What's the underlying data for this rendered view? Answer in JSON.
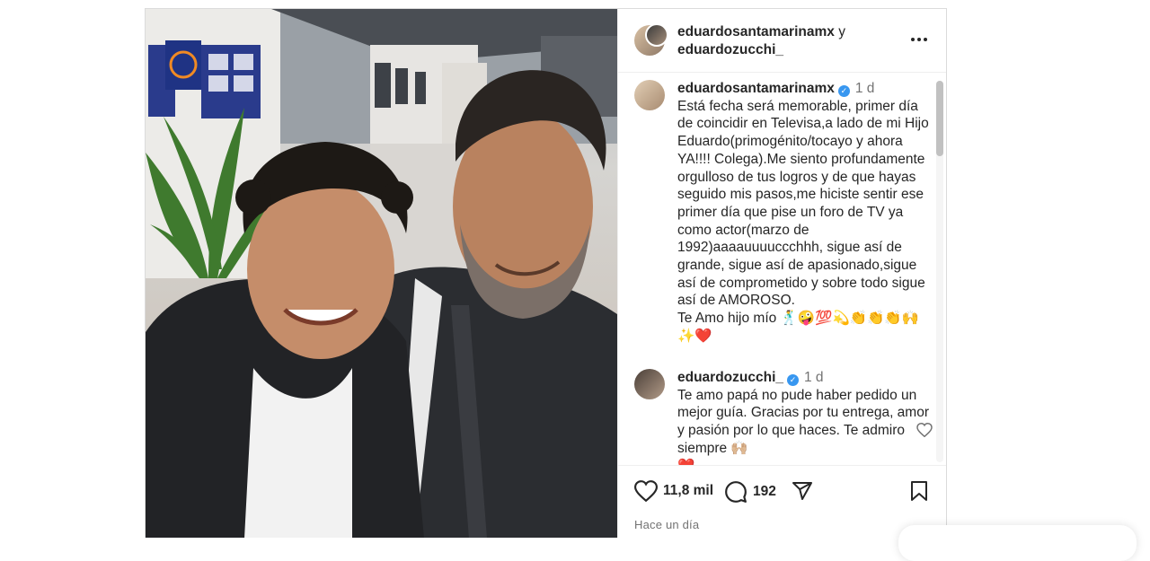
{
  "post": {
    "header": {
      "user1": "eduardosantamarinamx",
      "conjunction": "y",
      "user2": "eduardozucchi_",
      "more_icon": "more-horizontal-icon"
    },
    "comments": [
      {
        "username": "eduardosantamarinamx",
        "verified": true,
        "age": "1 d",
        "text": "Está fecha será memorable, primer día de coincidir en Televisa,a lado de mi Hijo Eduardo(primogénito/tocayo y ahora YA!!!! Colega).Me siento profundamente orgulloso de tus logros y de que hayas seguido mis pasos,me hiciste sentir ese primer día que pise un foro de TV ya como actor(marzo de 1992)aaaauuuuccchhh, sigue así de grande, sigue así de apasionado,sigue así de comprometido y sobre todo sigue así de AMOROSO.\nTe Amo hijo mío 🕺🤪💯💫👏👏👏🙌✨❤️"
      },
      {
        "username": "eduardozucchi_",
        "verified": true,
        "age": "1 d",
        "text": "Te amo papá no pude haber pedido un mejor guía. Gracias por tu entrega, amor y pasión por lo que haces. Te admiro siempre 🙌🏼\n❤️",
        "like_icon": "heart-outline-icon"
      }
    ],
    "actions": {
      "likes": "11,8 mil",
      "comments_count": "192",
      "like_icon": "heart-icon",
      "comment_icon": "comment-icon",
      "share_icon": "share-icon",
      "save_icon": "bookmark-icon"
    },
    "time_ago": "Hace un día"
  },
  "colors": {
    "verified": "#3897f0",
    "text": "#262626",
    "secondary": "#737373",
    "border": "#dbdbdb"
  }
}
